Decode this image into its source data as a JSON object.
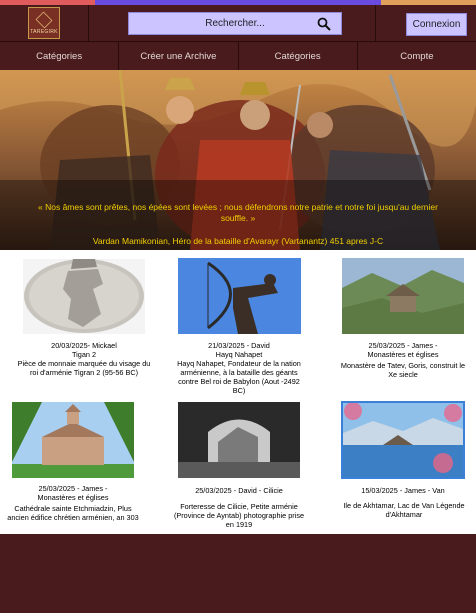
{
  "brand": {
    "logo_text": "TAREGIRK"
  },
  "header": {
    "search_placeholder": "Rechercher...",
    "login_label": "Connexion",
    "stripe_colors": [
      "#e05b5b",
      "#6a4be0",
      "#6a4be0",
      "#6a4be0",
      "#e0a05b"
    ]
  },
  "nav": {
    "items": [
      "Catégories",
      "Créer une Archive",
      "Catégories",
      "Compte"
    ]
  },
  "hero": {
    "quote": "« Nos âmes sont prêtes, nos épées sont levées ; nous défendrons notre patrie et notre foi jusqu'au dernier souffle. »",
    "attribution": "Vardan Mamikonian, Héro de la bataille d'Avarayr (Vartanantz)  451 apres J-C"
  },
  "cards": [
    {
      "meta1": "20/03/2025- Mickael",
      "meta2": "Tigan 2",
      "desc": "Pièce de monnaie marquée du visage du roi d'arménie Tigran 2 (95-56 BC)"
    },
    {
      "meta1": "21/03/2025 - David",
      "meta2": "Hayq Nahapet",
      "desc": "Hayq Nahapet, Fondateur de la nation arménienne, à la bataille des géants contre Bel roi de Babylon (Aout -2492 BC)"
    },
    {
      "meta1": "25/03/2025 - James -",
      "meta2": "Monastères et églises",
      "desc": "Monastère de Tatev, Goris, construit le Xe siecle"
    },
    {
      "meta1": "25/03/2025 - James -",
      "meta2": "Monastères et églises",
      "desc": "Cathédrale sainte Etchmiadzin, Plus ancien édifice chrétien arménien, an 303"
    },
    {
      "meta1": "25/03/2025 - David - Cilicie",
      "meta2": "",
      "desc": "Forteresse de Cilicie, Petite arménie (Province de Ayntab) photographie prise en 1919"
    },
    {
      "meta1": "15/03/2025 - James - Van",
      "meta2": "",
      "desc": "Ile de Akhtamar, Lac de Van Légende d'Akhtamar"
    }
  ]
}
